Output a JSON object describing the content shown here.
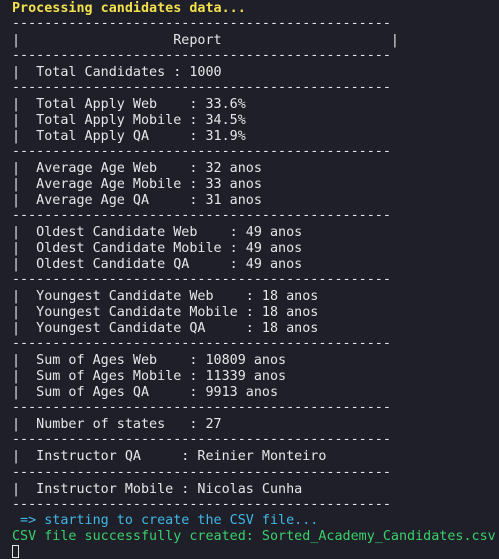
{
  "header": {
    "processing_msg": "Processing candidates data..."
  },
  "report": {
    "border": "-----------------------------------------------",
    "title_row": "|                   Report                     |",
    "total_candidates": "|  Total Candidates : 1000",
    "apply_web": "|  Total Apply Web    : 33.6%",
    "apply_mobile": "|  Total Apply Mobile : 34.5%",
    "apply_qa": "|  Total Apply QA     : 31.9%",
    "avg_web": "|  Average Age Web    : 32 anos",
    "avg_mobile": "|  Average Age Mobile : 33 anos",
    "avg_qa": "|  Average Age QA     : 31 anos",
    "oldest_web": "|  Oldest Candidate Web    : 49 anos",
    "oldest_mobile": "|  Oldest Candidate Mobile : 49 anos",
    "oldest_qa": "|  Oldest Candidate QA     : 49 anos",
    "youngest_web": "|  Youngest Candidate Web    : 18 anos",
    "youngest_mobile": "|  Youngest Candidate Mobile : 18 anos",
    "youngest_qa": "|  Youngest Candidate QA     : 18 anos",
    "sum_web": "|  Sum of Ages Web    : 10809 anos",
    "sum_mobile": "|  Sum of Ages Mobile : 11339 anos",
    "sum_qa": "|  Sum of Ages QA     : 9913 anos",
    "num_states": "|  Number of states   : 27",
    "instructor_qa": "|  Instructor QA     : Reinier Monteiro",
    "instructor_mobile": "|  Instructor Mobile : Nicolas Cunha"
  },
  "footer": {
    "csv_starting": " => starting to create the CSV file...",
    "csv_created": "CSV file successfully created: Sorted_Academy_Candidates.csv"
  },
  "colors": {
    "background": "#1e1f29",
    "text": "#e6e6e6",
    "yellow": "#f2e14b",
    "cyan": "#3fb8e6",
    "green": "#3ccf6a"
  }
}
